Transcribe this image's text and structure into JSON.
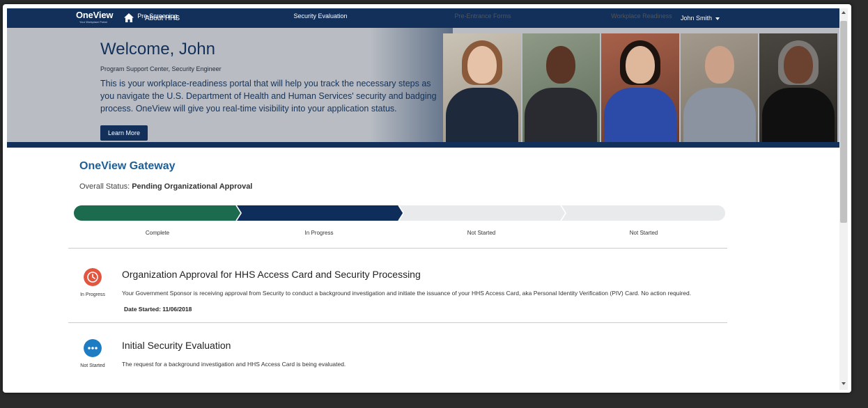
{
  "nav": {
    "logo": "OneView",
    "logo_tagline": "Your Workplace Portal",
    "about_label": "About HHS",
    "user_name": "John Smith"
  },
  "hero": {
    "welcome": "Welcome, John",
    "role": "Program Support Center, Security Engineer",
    "intro": "This is your workplace-readiness portal that will help you track the necessary steps as you navigate the U.S. Department of Health and Human Services' security and badging process. OneView will give you real-time visibility into your application status.",
    "learn_more": "Learn More"
  },
  "gateway": {
    "title": "OneView Gateway",
    "overall_label": "Overall Status:",
    "overall_value": "Pending Organizational Approval",
    "steps": [
      {
        "label": "Pre-Screening",
        "status": "Complete"
      },
      {
        "label": "Security Evaluation",
        "status": "In Progress"
      },
      {
        "label": "Pre-Entrance Forms",
        "status": "Not Started"
      },
      {
        "label": "Workplace Readiness",
        "status": "Not Started"
      }
    ]
  },
  "items": [
    {
      "icon": "clock-icon",
      "status": "In Progress",
      "title": "Organization Approval for HHS Access Card and Security Processing",
      "description": "Your Government Sponsor is receiving approval from Security to conduct a background investigation and initiate the issuance of your HHS Access Card, aka Personal Identity Verification (PIV) Card. No action required.",
      "date": "Date Started: 11/06/2018"
    },
    {
      "icon": "ellipsis-icon",
      "status": "Not Started",
      "title": "Initial Security Evaluation",
      "description": "The request for a background investigation and HHS Access Card is being evaluated."
    }
  ],
  "colors": {
    "navy": "#12305a",
    "step_complete": "#1c6b4e",
    "step_active": "#0f2d5a",
    "step_pending": "#e9eaec",
    "in_progress_icon": "#e2553f",
    "not_started_icon": "#1d7cc2"
  }
}
